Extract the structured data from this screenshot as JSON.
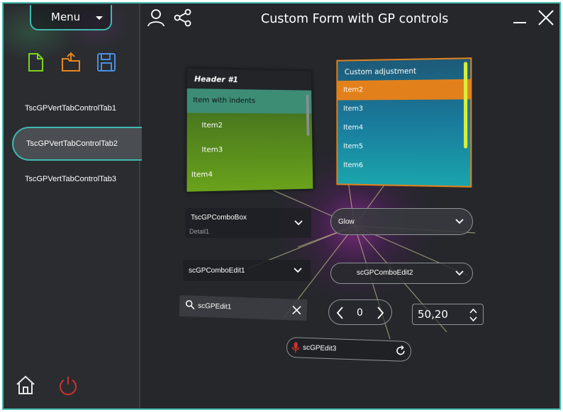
{
  "window": {
    "title": "Custom Form with GP controls",
    "accent_color": "#3fb9b1"
  },
  "menu": {
    "label": "Menu"
  },
  "toolbar": {
    "icons": [
      "new-file-icon",
      "open-folder-icon",
      "save-icon"
    ]
  },
  "sidebar": {
    "tabs": [
      {
        "label": "TscGPVertTabControlTab1"
      },
      {
        "label": "TscGPVertTabControlTab2",
        "selected": true
      },
      {
        "label": "TscGPVertTabControlTab3"
      }
    ],
    "bottom_icons": [
      "home-icon",
      "power-icon"
    ]
  },
  "titlebar_icons": [
    "user-icon",
    "share-icon",
    "minimize-icon",
    "close-icon"
  ],
  "list1": {
    "header": "Header #1",
    "items": [
      "Item with indents",
      "Item2",
      "Item3",
      "Item4"
    ],
    "selected_index": 0
  },
  "list2": {
    "header": "Custom adjustment",
    "items": [
      "Item2",
      "Item3",
      "Item4",
      "Item5",
      "Item6"
    ],
    "selected_index": 0,
    "selection_color": "#e2811c"
  },
  "combos": {
    "combo1": {
      "title": "TscGPComboBox",
      "detail": "Detail1"
    },
    "combo2": {
      "value": "Glow"
    },
    "combo3": {
      "value": "scGPComboEdit1"
    },
    "combo4": {
      "value": "scGPComboEdit2"
    }
  },
  "edits": {
    "edit1": {
      "value": "scGPEdit1"
    },
    "edit3": {
      "value": "scGPEdit3"
    }
  },
  "spin": {
    "value": "0"
  },
  "number": {
    "value": "50,20"
  }
}
